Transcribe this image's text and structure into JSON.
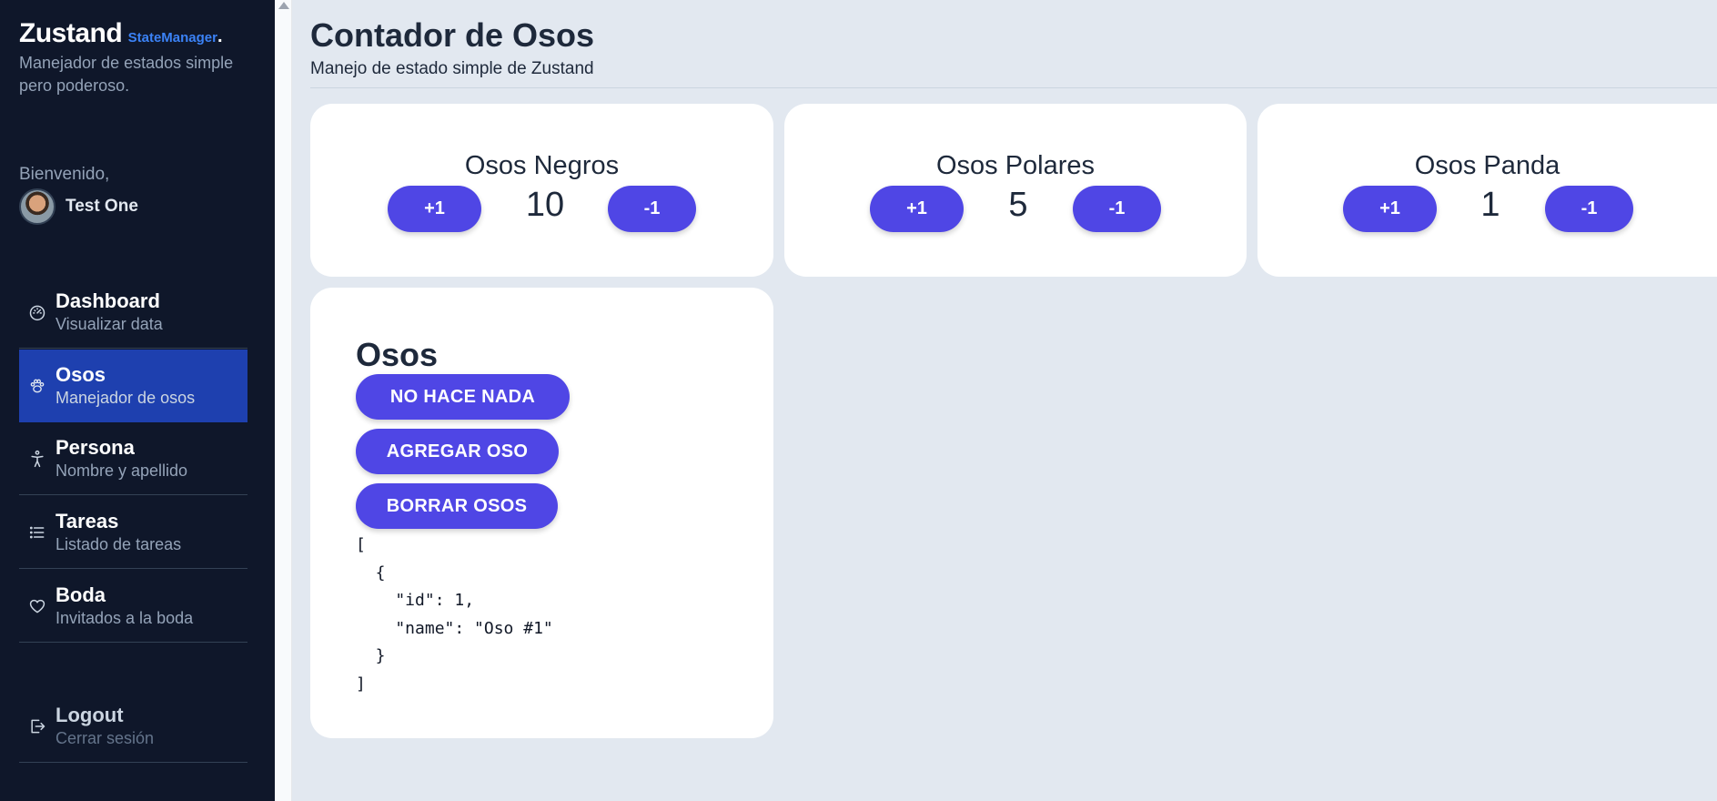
{
  "brand": {
    "title": "Zustand",
    "subtitle": "StateManager",
    "dot": ".",
    "description": "Manejador de estados simple pero poderoso."
  },
  "user": {
    "welcome": "Bienvenido,",
    "name": "Test One"
  },
  "nav": [
    {
      "title": "Dashboard",
      "subtitle": "Visualizar data",
      "icon": "gauge-icon",
      "active": false
    },
    {
      "title": "Osos",
      "subtitle": "Manejador de osos",
      "icon": "paw-icon",
      "active": true
    },
    {
      "title": "Persona",
      "subtitle": "Nombre y apellido",
      "icon": "person-icon",
      "active": false
    },
    {
      "title": "Tareas",
      "subtitle": "Listado de tareas",
      "icon": "list-icon",
      "active": false
    },
    {
      "title": "Boda",
      "subtitle": "Invitados a la boda",
      "icon": "heart-icon",
      "active": false
    }
  ],
  "logout": {
    "title": "Logout",
    "subtitle": "Cerrar sesión",
    "icon": "logout-icon"
  },
  "page": {
    "title": "Contador de Osos",
    "subtitle": "Manejo de estado simple de Zustand"
  },
  "counters": [
    {
      "title": "Osos Negros",
      "count": "10",
      "inc_label": "+1",
      "dec_label": "-1"
    },
    {
      "title": "Osos Polares",
      "count": "5",
      "inc_label": "+1",
      "dec_label": "-1"
    },
    {
      "title": "Osos Panda",
      "count": "1",
      "inc_label": "+1",
      "dec_label": "-1"
    }
  ],
  "bears_card": {
    "title": "Osos",
    "buttons": [
      "NO HACE NADA",
      "AGREGAR OSO",
      "BORRAR OSOS"
    ],
    "json_output": "[\n  {\n    \"id\": 1,\n    \"name\": \"Oso #1\"\n  }\n]"
  },
  "colors": {
    "sidebar_bg": "#0f172a",
    "active_nav": "#1e40af",
    "accent": "#4f46e5",
    "brand_blue": "#3b82f6",
    "page_bg": "#e2e8f0"
  }
}
